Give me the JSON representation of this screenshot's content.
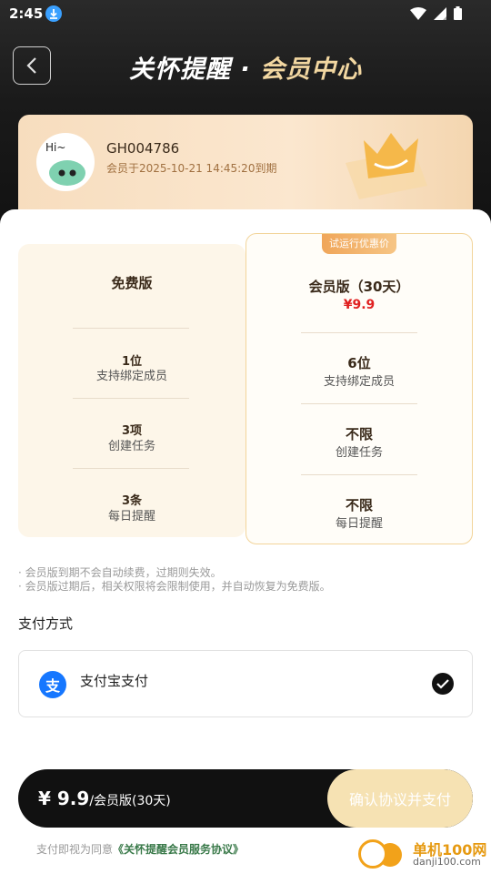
{
  "status_bar": {
    "time": "2:45"
  },
  "header": {
    "title_left": "关怀提醒",
    "title_dot": " · ",
    "title_right": "会员中心"
  },
  "member": {
    "user_id": "GH004786",
    "expire_text": "会员于2025-10-21 14:45:20到期",
    "avatar_text": "Hi~"
  },
  "plans": {
    "free": {
      "name": "免费版",
      "features": [
        {
          "value": "1位",
          "label": "支持绑定成员"
        },
        {
          "value": "3项",
          "label": "创建任务"
        },
        {
          "value": "3条",
          "label": "每日提醒"
        }
      ]
    },
    "vip": {
      "tag": "试运行优惠价",
      "name": "会员版（30天）",
      "price": "¥9.9",
      "features": [
        {
          "value": "6位",
          "label": "支持绑定成员"
        },
        {
          "value": "不限",
          "label": "创建任务"
        },
        {
          "value": "不限",
          "label": "每日提醒"
        }
      ]
    }
  },
  "notes": [
    "· 会员版到期不会自动续费，过期则失效。",
    "· 会员版过期后，相关权限将会限制使用，并自动恢复为免费版。"
  ],
  "payment": {
    "heading": "支付方式",
    "option_label": "支付宝支付",
    "option_icon_char": "支"
  },
  "paybar": {
    "price": "¥ 9.9",
    "suffix": "/会员版(30天)",
    "confirm_label": "确认协议并支付"
  },
  "agreement": {
    "prefix": "支付即视为同意",
    "link": "《关怀提醒会员服务协议》"
  },
  "watermark": {
    "name": "单机100网",
    "url": "danji100.com"
  },
  "colors": {
    "accent_gold": "#f2d7a1",
    "price_red": "#e02020",
    "alipay_blue": "#1677ff"
  }
}
